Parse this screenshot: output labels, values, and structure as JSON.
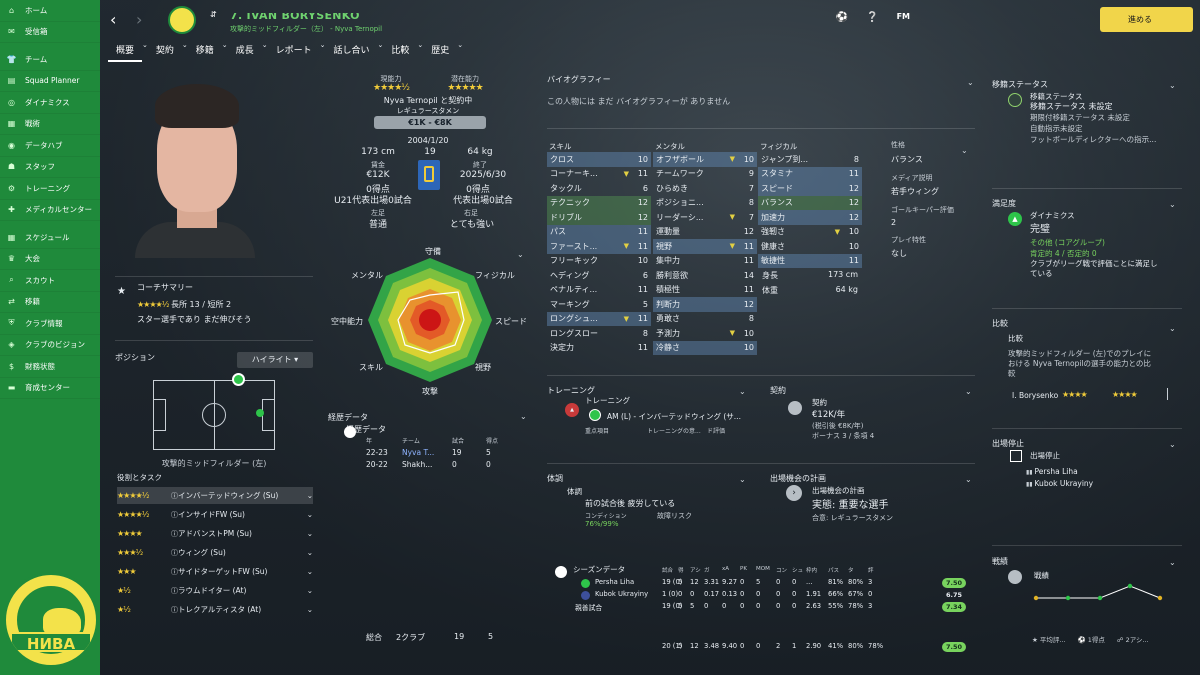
{
  "sidebar": {
    "items": [
      {
        "label": "ホーム",
        "icon": "home-icon"
      },
      {
        "label": "受信箱",
        "icon": "inbox-icon"
      },
      {
        "label": "チーム",
        "icon": "team-icon"
      },
      {
        "label": "Squad Planner",
        "icon": "planner-icon"
      },
      {
        "label": "ダイナミクス",
        "icon": "dynamics-icon"
      },
      {
        "label": "戦術",
        "icon": "tactics-icon"
      },
      {
        "label": "データハブ",
        "icon": "datahub-icon"
      },
      {
        "label": "スタッフ",
        "icon": "staff-icon"
      },
      {
        "label": "トレーニング",
        "icon": "training-icon"
      },
      {
        "label": "メディカルセンター",
        "icon": "medical-icon"
      },
      {
        "label": "スケジュール",
        "icon": "calendar-icon"
      },
      {
        "label": "大会",
        "icon": "trophy-icon"
      },
      {
        "label": "スカウト",
        "icon": "scout-icon"
      },
      {
        "label": "移籍",
        "icon": "transfer-icon"
      },
      {
        "label": "クラブ情報",
        "icon": "club-info-icon"
      },
      {
        "label": "クラブのビジョン",
        "icon": "vision-icon"
      },
      {
        "label": "財務状態",
        "icon": "finance-icon"
      },
      {
        "label": "育成センター",
        "icon": "youth-icon"
      }
    ],
    "club_word": "НИВА"
  },
  "header": {
    "player_name": "7. IVAN BORYSENKO",
    "subtitle": "攻撃的ミッドフィルダー（左） - Nyva Ternopil",
    "fm": "FM",
    "continue": "進める"
  },
  "tabs": [
    "概要",
    "契約",
    "移籍",
    "成長",
    "レポート",
    "話し合い",
    "比較",
    "歴史"
  ],
  "bio": {
    "current_label": "現能力",
    "potential_label": "潜在能力",
    "current_stars": "★★★★½",
    "potential_stars": "★★★★★",
    "club_line": "Nyva Ternopil と契約中",
    "role": "レギュラースタメン",
    "value": "€1K - €8K",
    "dob": "2004/1/20",
    "height": "173 cm",
    "age": "19",
    "weight": "64 kg",
    "wage_label": "賃金",
    "wage": "€12K",
    "expiry_label": "終了",
    "expiry": "2025/6/30",
    "goals1": "0得点",
    "goals2": "0得点",
    "u21": "U21代表出場0試合",
    "intl": "代表出場0試合",
    "left_foot_label": "左足",
    "left_foot": "普通",
    "right_foot_label": "右足",
    "right_foot": "とても強い"
  },
  "coach": {
    "title": "コーチサマリー",
    "line1": "長所 13 / 短所 2",
    "line2": "スター選手であり まだ伸びそう",
    "stars": "★★★★½"
  },
  "position": {
    "title": "ポジション",
    "dropdown": "ハイライト",
    "role": "攻撃的ミッドフィルダー (左)"
  },
  "roles_title": "役割とタスク",
  "roles": [
    {
      "stars": "★★★★½",
      "name": "インバーテッドウィング (Su)"
    },
    {
      "stars": "★★★★½",
      "name": "インサイドFW (Su)"
    },
    {
      "stars": "★★★★",
      "name": "アドバンストPM (Su)"
    },
    {
      "stars": "★★★½",
      "name": "ウィング (Su)"
    },
    {
      "stars": "★★★",
      "name": "サイドターゲットFW (Su)"
    },
    {
      "stars": "★½",
      "name": "ラウムドイター (At)"
    },
    {
      "stars": "★½",
      "name": "トレクアルティスタ (At)"
    }
  ],
  "radar": {
    "labels": [
      "守備",
      "フィジカル",
      "スピード",
      "視野",
      "攻撃",
      "スキル",
      "空中能力",
      "メンタル"
    ]
  },
  "history": {
    "title": "経歴データ",
    "subtitle": "経歴データ",
    "cols": [
      "年",
      "チーム",
      "試合",
      "得点"
    ],
    "rows": [
      [
        "22-23",
        "Nyva T...",
        "19",
        "5"
      ],
      [
        "20-22",
        "Shakh...",
        "0",
        "0"
      ]
    ],
    "total_label": "総合",
    "total_clubs": "2クラブ",
    "total_apps": "19",
    "total_goals": "5"
  },
  "attrs": {
    "skill_title": "スキル",
    "mental_title": "メンタル",
    "physical_title": "フィジカル",
    "skill": [
      [
        "クロス",
        "10"
      ],
      [
        "コーナーキ...",
        "11"
      ],
      [
        "タックル",
        "6"
      ],
      [
        "テクニック",
        "12"
      ],
      [
        "ドリブル",
        "12"
      ],
      [
        "パス",
        "11"
      ],
      [
        "ファースト...",
        "11"
      ],
      [
        "フリーキック",
        "10"
      ],
      [
        "ヘディング",
        "6"
      ],
      [
        "ペナルティ...",
        "11"
      ],
      [
        "マーキング",
        "5"
      ],
      [
        "ロングシュ...",
        "11"
      ],
      [
        "ロングスロー",
        "8"
      ],
      [
        "決定力",
        "11"
      ]
    ],
    "mental": [
      [
        "オフザボール",
        "10"
      ],
      [
        "チームワーク",
        "9"
      ],
      [
        "ひらめき",
        "7"
      ],
      [
        "ポジショニ...",
        "8"
      ],
      [
        "リーダーシ...",
        "7"
      ],
      [
        "運動量",
        "12"
      ],
      [
        "視野",
        "11"
      ],
      [
        "集中力",
        "11"
      ],
      [
        "勝利意欲",
        "14"
      ],
      [
        "積極性",
        "11"
      ],
      [
        "判断力",
        "12"
      ],
      [
        "勇敢さ",
        "8"
      ],
      [
        "予測力",
        "10"
      ],
      [
        "冷静さ",
        "10"
      ]
    ],
    "physical": [
      [
        "ジャンプ到...",
        "8"
      ],
      [
        "スタミナ",
        "11"
      ],
      [
        "スピード",
        "12"
      ],
      [
        "バランス",
        "12"
      ],
      [
        "加速力",
        "12"
      ],
      [
        "強靭さ",
        "10"
      ],
      [
        "健康さ",
        "10"
      ],
      [
        "敏捷性",
        "11"
      ]
    ],
    "height_label": "身長",
    "height": "173 cm",
    "weight_label": "体重",
    "weight": "64 kg"
  },
  "personality": {
    "title": "性格",
    "value": "バランス",
    "media_title": "メディア説明",
    "media": "若手ウィング",
    "gk_title": "ゴールキーパー評価",
    "gk": "2",
    "traits_title": "プレイ特性",
    "traits": "なし"
  },
  "biography": {
    "title": "バイオグラフィー",
    "text": "この人物には まだ バイオグラフィーが ありません"
  },
  "transfer": {
    "title": "移籍ステータス",
    "sub": "移籍ステータス",
    "status": "移籍ステータス 未設定",
    "loan": "期限付移籍ステータス 未設定",
    "release": "自動指示未設定",
    "director": "フットボールディレクターへの指示..."
  },
  "satisfaction": {
    "title": "満足度",
    "sub": "ダイナミクス",
    "value": "完璧",
    "group": "その他 (コアグループ)",
    "counts": "肯定的 4 / 否定的 0",
    "note": "クラブがリーグ戦で評価ことに満足している"
  },
  "compare": {
    "title": "比較",
    "sub": "比較",
    "text": "攻撃的ミッドフィルダー (左)でのプレイにおける Nyva Ternopilの選手の能力との比較",
    "name": "I. Borysenko",
    "stars": "★★★★",
    "stars2": "★★★★"
  },
  "suspension": {
    "title": "出場停止",
    "sub": "出場停止",
    "teams": [
      "Persha Liha",
      "Kubok Ukrayiny"
    ]
  },
  "form": {
    "title": "戦績",
    "sub": "戦績",
    "legend": [
      "平均評...",
      "1得点",
      "2アシ..."
    ]
  },
  "training": {
    "title": "トレーニング",
    "sub": "トレーニング",
    "role": "AM (L) - インバーテッドウィング (サ...",
    "focus_label": "重点項目",
    "intensity_label": "トレーニングの意...",
    "intensity_value": "ド評価"
  },
  "contract": {
    "title": "契約",
    "sub": "契約",
    "wage": "€12K/年",
    "gross": "(税引後 €8K/年)",
    "bonus": "ボーナス 3 / 条項 4"
  },
  "condition": {
    "title": "体調",
    "sub": "体調",
    "text": "前の試合後 疲労している",
    "cond_label": "コンディション",
    "cond": "76%/99%",
    "injury": "故障リスク"
  },
  "playtime": {
    "title": "出場機会の計画",
    "sub": "出場機会の計画",
    "value": "実態: 重要な選手",
    "agreed": "合意: レギュラースタメン"
  },
  "season": {
    "title": "シーズンデータ",
    "cols": [
      "試合",
      "得",
      "アシ",
      "ガ",
      "xA",
      "PK",
      "MOM",
      "コン",
      "シュ",
      "枠内",
      "パス",
      "タ",
      "評"
    ],
    "rows": [
      {
        "team": "Persha Liha",
        "vals": [
          "19 (0)",
          "5",
          "12",
          "3.31",
          "9.27",
          "0",
          "5",
          "0",
          "0",
          "...",
          "81%",
          "80%",
          "3"
        ],
        "rating": "7.50"
      },
      {
        "team": "Kubok Ukrayiny",
        "vals": [
          "1 (0)",
          "0",
          "0",
          "0.17",
          "0.13",
          "0",
          "0",
          "0",
          "0",
          "1.91",
          "66%",
          "67%",
          "0"
        ],
        "rating": "6.75"
      },
      {
        "team": "親善試合",
        "vals": [
          "19 (0)",
          "5",
          "5",
          "0",
          "0",
          "0",
          "0",
          "0",
          "0",
          "2.63",
          "55%",
          "78%",
          "3"
        ],
        "rating": "7.34"
      },
      {
        "team": "",
        "vals": [
          "20 (1)",
          "5",
          "12",
          "3.48",
          "9.40",
          "0",
          "0",
          "2",
          "1",
          "2.90",
          "41%",
          "80%",
          "78%"
        ],
        "rating": "7.50"
      }
    ]
  },
  "colors": {
    "accent": "#1f8a3b",
    "gold": "#f1cc3a",
    "continue": "#f1d54a"
  }
}
